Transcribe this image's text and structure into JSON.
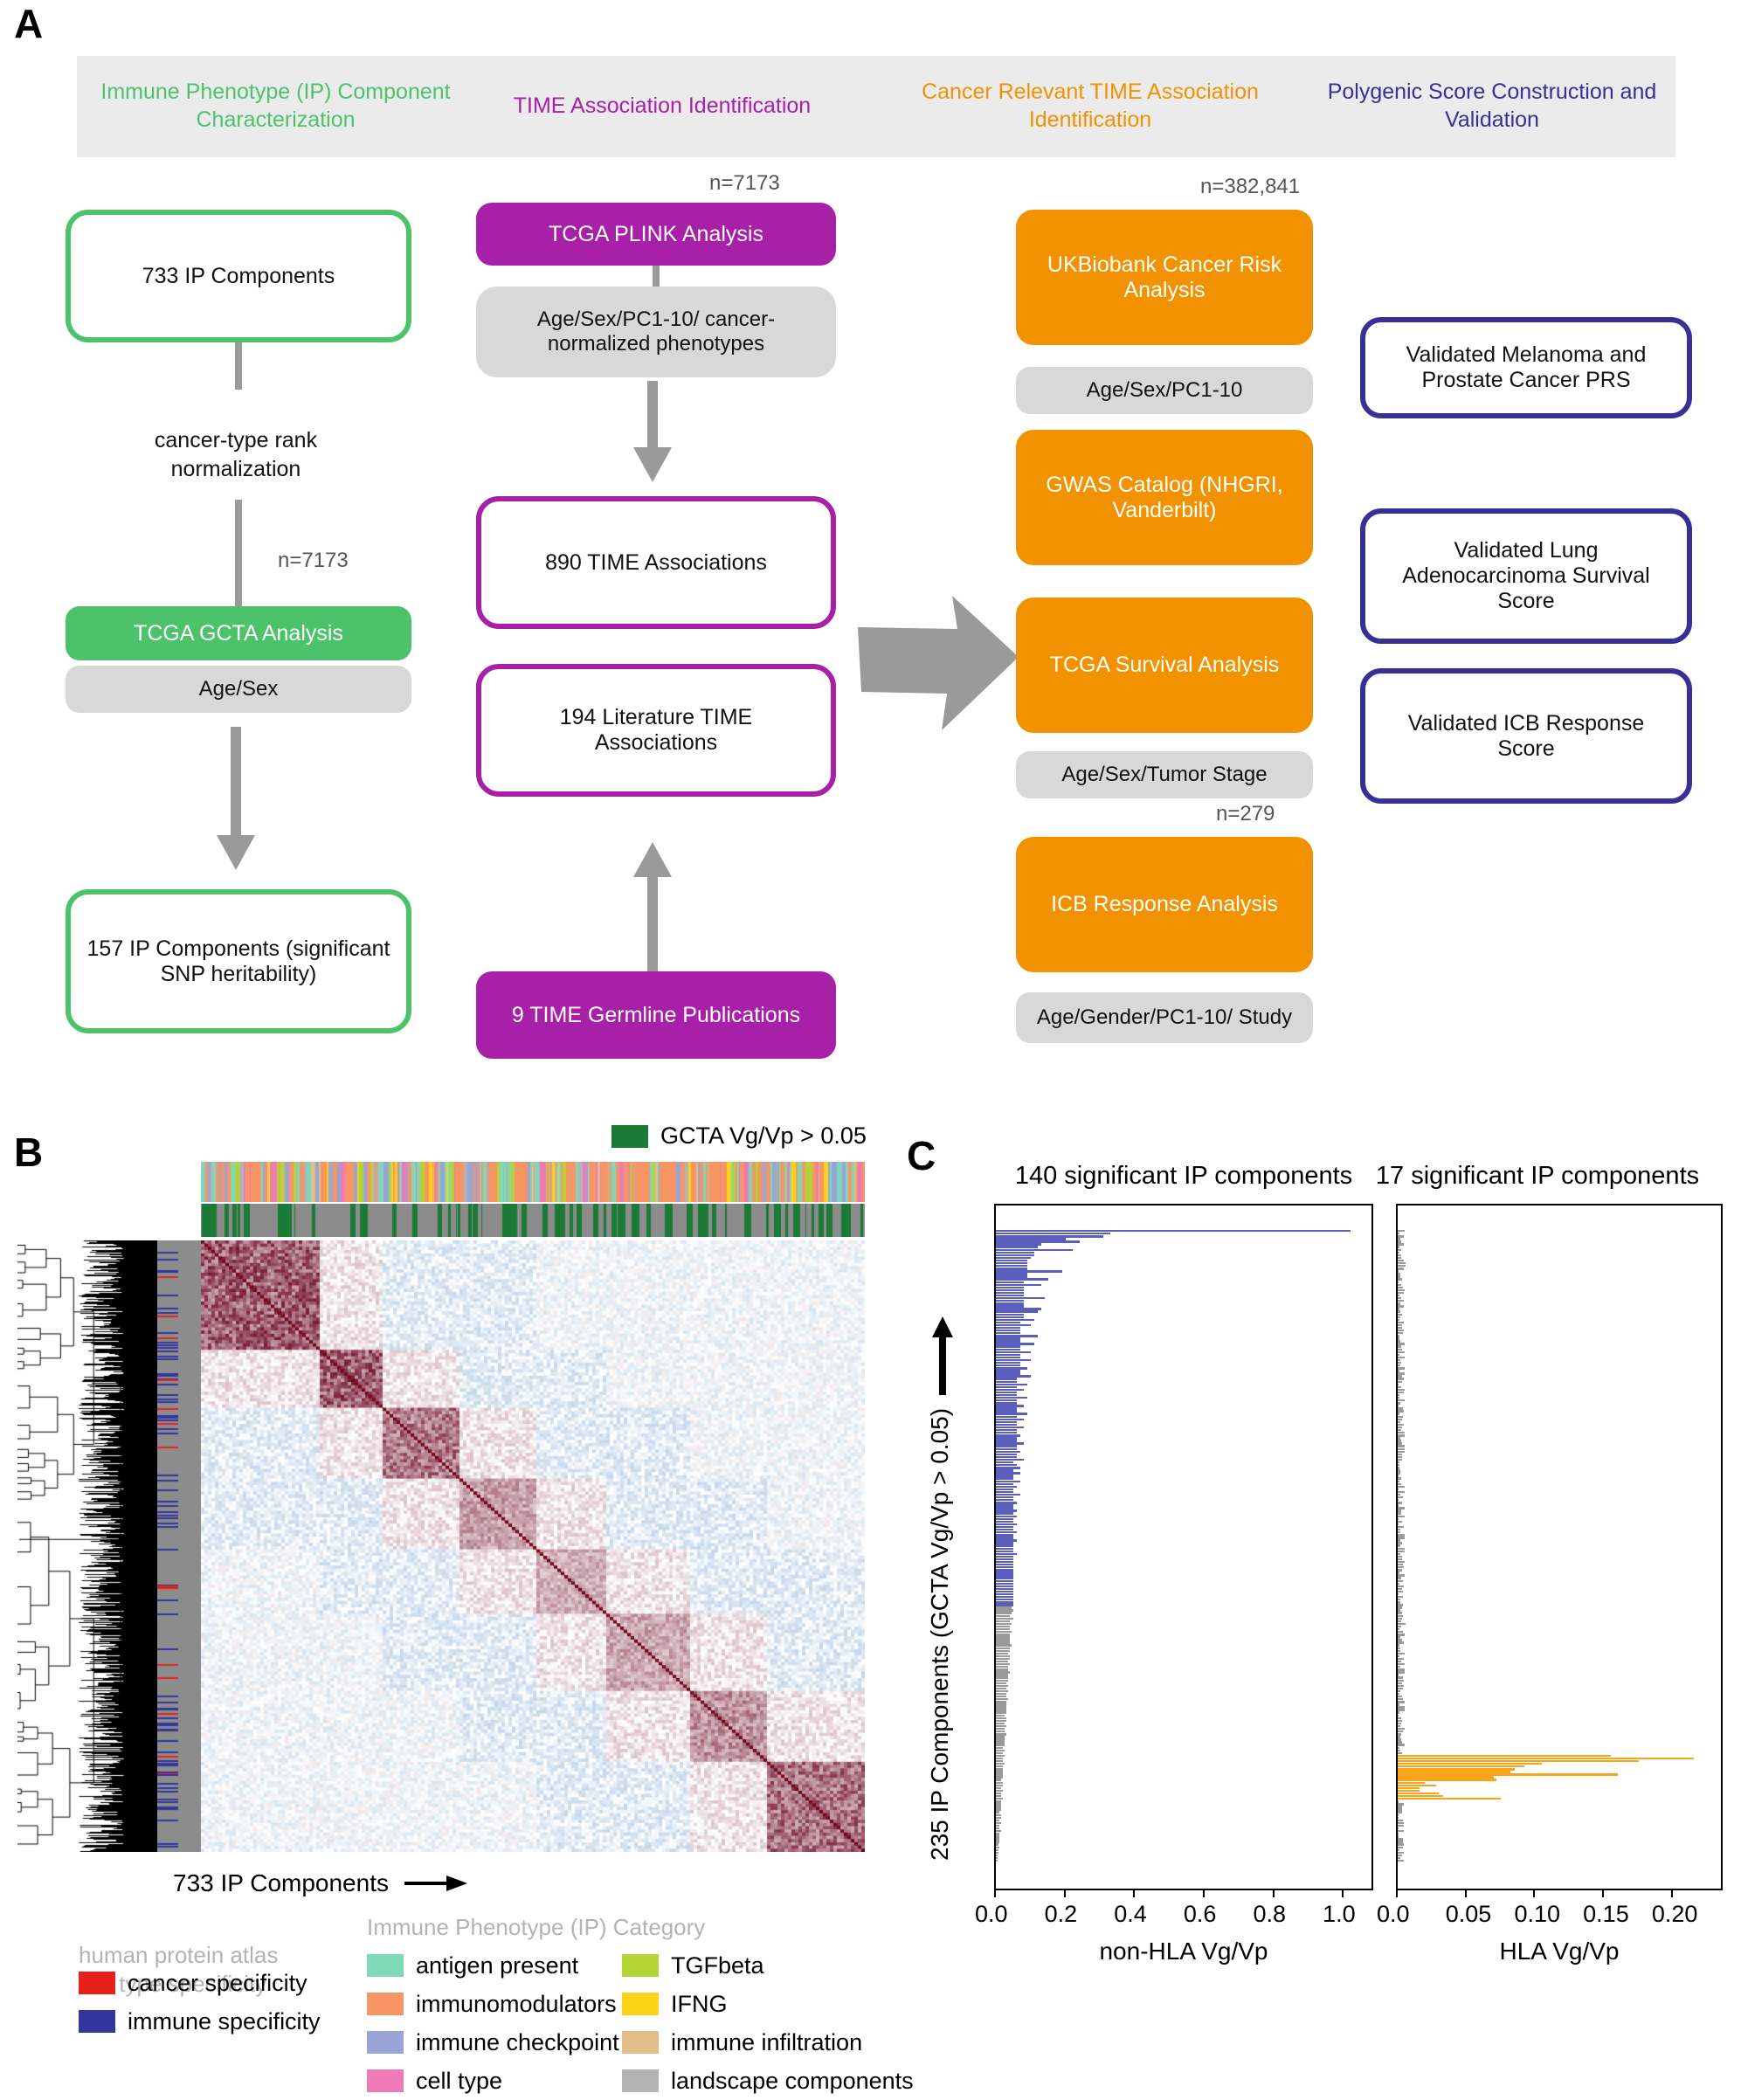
{
  "panels": {
    "a_letter": "A",
    "b_letter": "B",
    "c_letter": "C"
  },
  "flow": {
    "headers": [
      {
        "text": "Immune Phenotype (IP) Component Characterization",
        "color": "#4cc36a"
      },
      {
        "text": "TIME Association Identification",
        "color": "#a81fa8"
      },
      {
        "text": "Cancer Relevant TIME Association Identification",
        "color": "#f39200"
      },
      {
        "text": "Polygenic Score Construction and Validation",
        "color": "#3a2f96"
      }
    ],
    "col1": {
      "box_733": "733 IP Components",
      "step_label": "cancer-type rank normalization",
      "n_gcta": "n=7173",
      "gcta": "TCGA GCTA Analysis",
      "gcta_cov": "Age/Sex",
      "box_157": "157 IP Components (significant SNP heritability)"
    },
    "col2": {
      "n_plink": "n=7173",
      "plink": "TCGA PLINK Analysis",
      "plink_cov": "Age/Sex/PC1-10/ cancer-normalized phenotypes",
      "box_890": "890 TIME Associations",
      "box_194": "194 Literature TIME Associations",
      "pubs": "9 TIME Germline Publications"
    },
    "col3": {
      "n_ukb": "n=382,841",
      "ukb": "UKBiobank Cancer Risk Analysis",
      "ukb_cov": "Age/Sex/PC1-10",
      "gwas": "GWAS Catalog (NHGRI, Vanderbilt)",
      "survival": "TCGA Survival Analysis",
      "survival_cov": "Age/Sex/Tumor Stage",
      "n_icb": "n=279",
      "icb": "ICB Response Analysis",
      "icb_cov": "Age/Gender/PC1-10/ Study"
    },
    "col4": {
      "prs": "Validated Melanoma and Prostate Cancer PRS",
      "lung": "Validated Lung Adenocarcinoma Survival Score",
      "icb_score": "Validated ICB Response Score"
    }
  },
  "heatmap": {
    "top_legend_label": "GCTA Vg/Vp > 0.05",
    "top_legend_color": "#1a7a36",
    "x_axis_label": "733 IP Components",
    "category_legend_title": "Immune Phenotype (IP) Category",
    "hpa_title": "human protein atlas cell type specificity",
    "hpa_items": [
      {
        "label": "cancer specificity",
        "color": "#e8201c"
      },
      {
        "label": "immune specificity",
        "color": "#33369c"
      }
    ],
    "category_items_left": [
      {
        "label": "antigen present",
        "color": "#7fd9b9"
      },
      {
        "label": "immunomodulators",
        "color": "#f79564"
      },
      {
        "label": "immune checkpoint",
        "color": "#99a4d8"
      },
      {
        "label": "cell type",
        "color": "#ee7ab8"
      }
    ],
    "category_items_right": [
      {
        "label": "TGFbeta",
        "color": "#b4d335"
      },
      {
        "label": "IFNG",
        "color": "#fcd315"
      },
      {
        "label": "immune infiltration",
        "color": "#e2bd87"
      },
      {
        "label": "landscape components",
        "color": "#b3b3b3"
      }
    ]
  },
  "chart_data": [
    {
      "type": "bar",
      "orientation": "horizontal",
      "title": "140 significant IP components",
      "xlabel": "non-HLA Vg/Vp",
      "ylabel": "235 IP Components (GCTA Vg/Vp > 0.05)",
      "xlim": [
        0.0,
        1.08
      ],
      "xticks": [
        0.0,
        0.2,
        0.4,
        0.6,
        0.8,
        1.0
      ],
      "xticklabels": [
        "0.0",
        "0.2",
        "0.4",
        "0.6",
        "0.8",
        "1.0"
      ],
      "grid": false,
      "legend": "none",
      "n_bars": 235,
      "series": [
        {
          "name": "significant (non-HLA)",
          "color": "#5a5fbe",
          "count": 140
        },
        {
          "name": "non-significant",
          "color": "#9a9a9a",
          "count": 95
        }
      ],
      "values": [
        1.02,
        0.33,
        0.31,
        0.2,
        0.24,
        0.13,
        0.12,
        0.22,
        0.11,
        0.11,
        0.1,
        0.09,
        0.09,
        0.09,
        0.09,
        0.19,
        0.09,
        0.09,
        0.15,
        0.08,
        0.13,
        0.08,
        0.08,
        0.08,
        0.08,
        0.14,
        0.08,
        0.08,
        0.08,
        0.13,
        0.12,
        0.08,
        0.08,
        0.11,
        0.07,
        0.1,
        0.07,
        0.07,
        0.07,
        0.12,
        0.07,
        0.07,
        0.11,
        0.07,
        0.07,
        0.1,
        0.07,
        0.07,
        0.1,
        0.07,
        0.07,
        0.09,
        0.07,
        0.07,
        0.1,
        0.06,
        0.06,
        0.09,
        0.06,
        0.08,
        0.06,
        0.06,
        0.09,
        0.06,
        0.06,
        0.08,
        0.06,
        0.06,
        0.09,
        0.06,
        0.08,
        0.06,
        0.06,
        0.08,
        0.06,
        0.06,
        0.07,
        0.06,
        0.06,
        0.08,
        0.06,
        0.06,
        0.07,
        0.06,
        0.06,
        0.08,
        0.05,
        0.06,
        0.07,
        0.05,
        0.07,
        0.05,
        0.05,
        0.07,
        0.05,
        0.06,
        0.05,
        0.05,
        0.07,
        0.05,
        0.05,
        0.06,
        0.05,
        0.05,
        0.06,
        0.05,
        0.06,
        0.05,
        0.05,
        0.06,
        0.05,
        0.05,
        0.06,
        0.05,
        0.05,
        0.06,
        0.05,
        0.05,
        0.05,
        0.05,
        0.06,
        0.05,
        0.05,
        0.05,
        0.05,
        0.05,
        0.05,
        0.05,
        0.05,
        0.05,
        0.05,
        0.05,
        0.05,
        0.05,
        0.05,
        0.05,
        0.05,
        0.05,
        0.05,
        0.05,
        0.045,
        0.05,
        0.045,
        0.04,
        0.05,
        0.04,
        0.045,
        0.04,
        0.04,
        0.045,
        0.04,
        0.04,
        0.04,
        0.04,
        0.045,
        0.04,
        0.04,
        0.035,
        0.04,
        0.04,
        0.035,
        0.04,
        0.035,
        0.035,
        0.04,
        0.035,
        0.035,
        0.035,
        0.03,
        0.035,
        0.03,
        0.035,
        0.03,
        0.03,
        0.035,
        0.03,
        0.03,
        0.03,
        0.03,
        0.03,
        0.025,
        0.03,
        0.03,
        0.025,
        0.03,
        0.025,
        0.025,
        0.03,
        0.025,
        0.025,
        0.025,
        0.025,
        0.02,
        0.025,
        0.02,
        0.025,
        0.02,
        0.02,
        0.025,
        0.02,
        0.02,
        0.02,
        0.02,
        0.02,
        0.015,
        0.02,
        0.02,
        0.015,
        0.02,
        0.015,
        0.015,
        0.02,
        0.015,
        0.015,
        0.015,
        0.015,
        0.01,
        0.015,
        0.015,
        0.01,
        0.015,
        0.01,
        0.01,
        0.015,
        0.01,
        0.01,
        0.01,
        0.01,
        0.008,
        0.01,
        0.008,
        0.008,
        0.006,
        0.005,
        0.004
      ]
    },
    {
      "type": "bar",
      "orientation": "horizontal",
      "title": "17 significant IP components",
      "xlabel": "HLA Vg/Vp",
      "xlim": [
        0.0,
        0.235
      ],
      "xticks": [
        0.0,
        0.05,
        0.1,
        0.15,
        0.2
      ],
      "xticklabels": [
        "0.0",
        "0.05",
        "0.10",
        "0.15",
        "0.20"
      ],
      "grid": false,
      "legend": "none",
      "n_bars": 235,
      "series": [
        {
          "name": "significant (HLA)",
          "color": "#f9a51a",
          "count": 17
        },
        {
          "name": "non-significant",
          "color": "#9a9a9a",
          "count": 218
        }
      ],
      "values_significant": [
        0.155,
        0.215,
        0.175,
        0.105,
        0.092,
        0.085,
        0.082,
        0.16,
        0.07,
        0.072,
        0.02,
        0.028,
        0.016,
        0.016,
        0.03,
        0.033,
        0.075
      ]
    }
  ]
}
